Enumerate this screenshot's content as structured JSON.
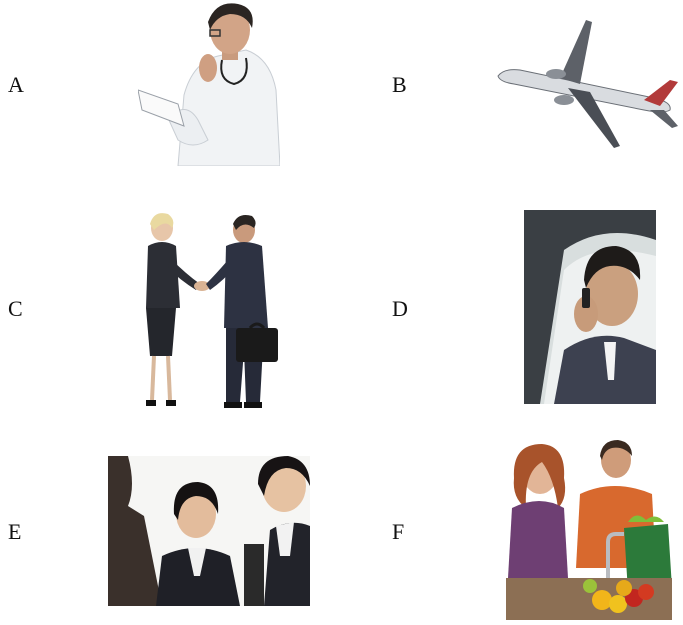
{
  "options": [
    {
      "letter": "A",
      "icon": "doctor-reading-photo"
    },
    {
      "letter": "B",
      "icon": "airplane-photo"
    },
    {
      "letter": "C",
      "icon": "business-handshake-photo"
    },
    {
      "letter": "D",
      "icon": "man-phone-in-car-photo"
    },
    {
      "letter": "E",
      "icon": "business-meeting-photo"
    },
    {
      "letter": "F",
      "icon": "couple-kitchen-groceries-photo"
    }
  ]
}
